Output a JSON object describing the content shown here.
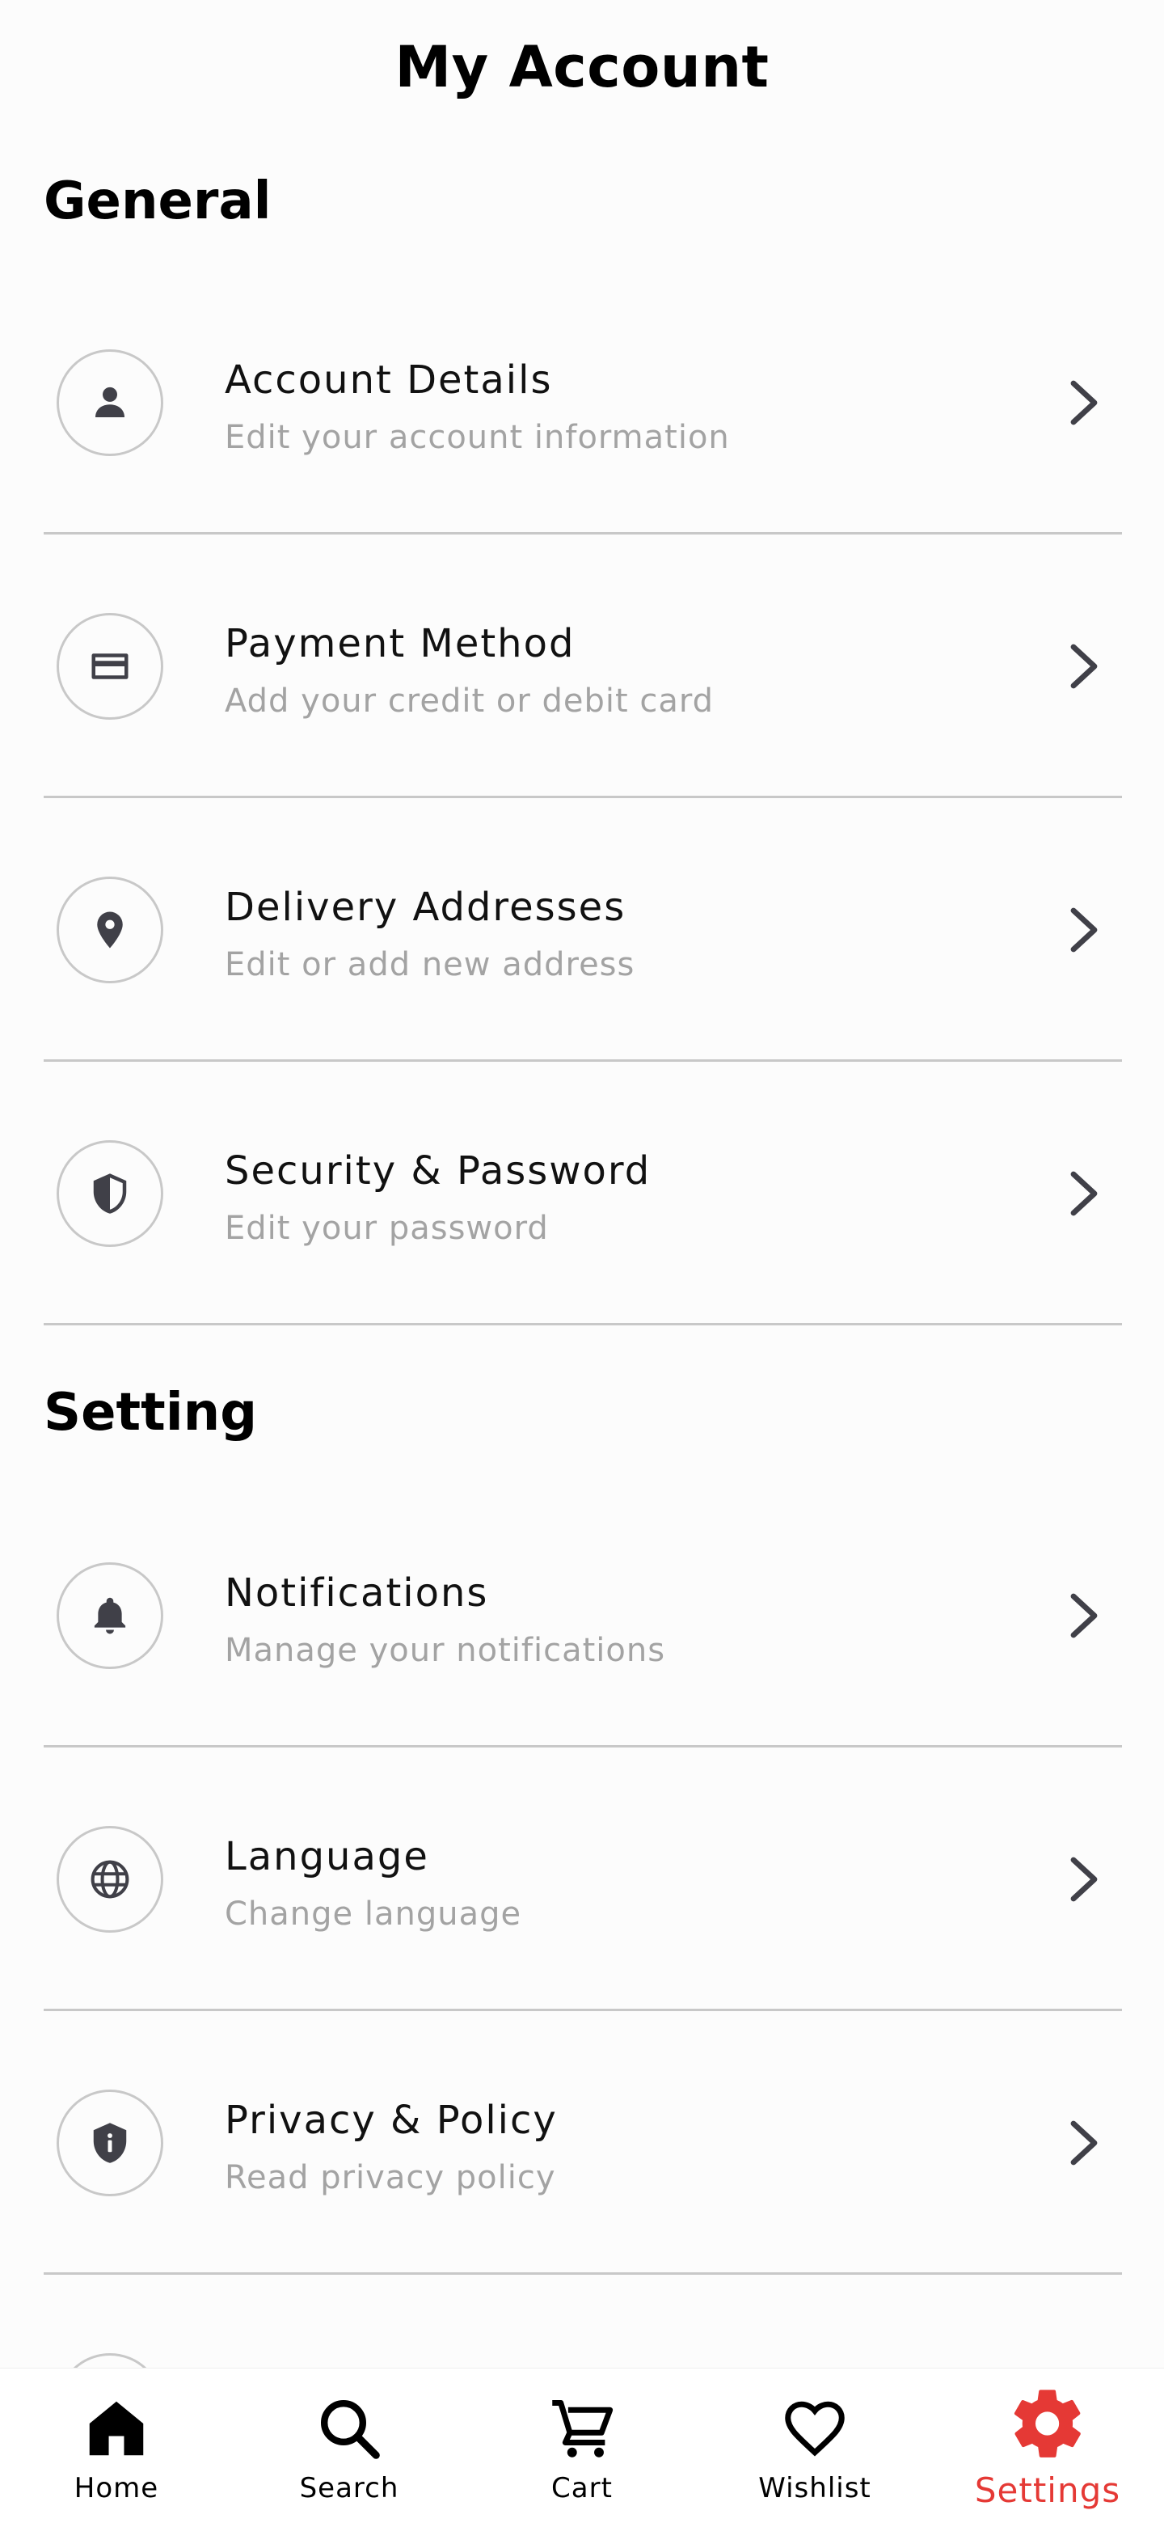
{
  "header": {
    "title": "My Account"
  },
  "sections": {
    "general": {
      "title": "General",
      "items": [
        {
          "title": "Account Details",
          "subtitle": "Edit your account information",
          "icon": "person-icon"
        },
        {
          "title": "Payment Method",
          "subtitle": "Add your credit or debit card",
          "icon": "credit-card-icon"
        },
        {
          "title": "Delivery Addresses",
          "subtitle": "Edit or add new address",
          "icon": "location-pin-icon"
        },
        {
          "title": "Security & Password",
          "subtitle": "Edit your password",
          "icon": "shield-icon"
        }
      ]
    },
    "setting": {
      "title": "Setting",
      "items": [
        {
          "title": "Notifications",
          "subtitle": "Manage your notifications",
          "icon": "bell-icon"
        },
        {
          "title": "Language",
          "subtitle": "Change language",
          "icon": "globe-icon"
        },
        {
          "title": "Privacy & Policy",
          "subtitle": "Read privacy policy",
          "icon": "privacy-shield-icon"
        }
      ]
    }
  },
  "bottom_nav": {
    "items": [
      {
        "label": "Home",
        "icon": "home-icon"
      },
      {
        "label": "Search",
        "icon": "search-icon"
      },
      {
        "label": "Cart",
        "icon": "cart-icon"
      },
      {
        "label": "Wishlist",
        "icon": "heart-icon"
      },
      {
        "label": "Settings",
        "icon": "gear-icon",
        "active": true
      }
    ]
  },
  "colors": {
    "accent": "#e53935",
    "icon": "#404048",
    "subtitle": "#a3a3a3",
    "divider": "#c8c8c8",
    "background": "#fcfcfc"
  }
}
